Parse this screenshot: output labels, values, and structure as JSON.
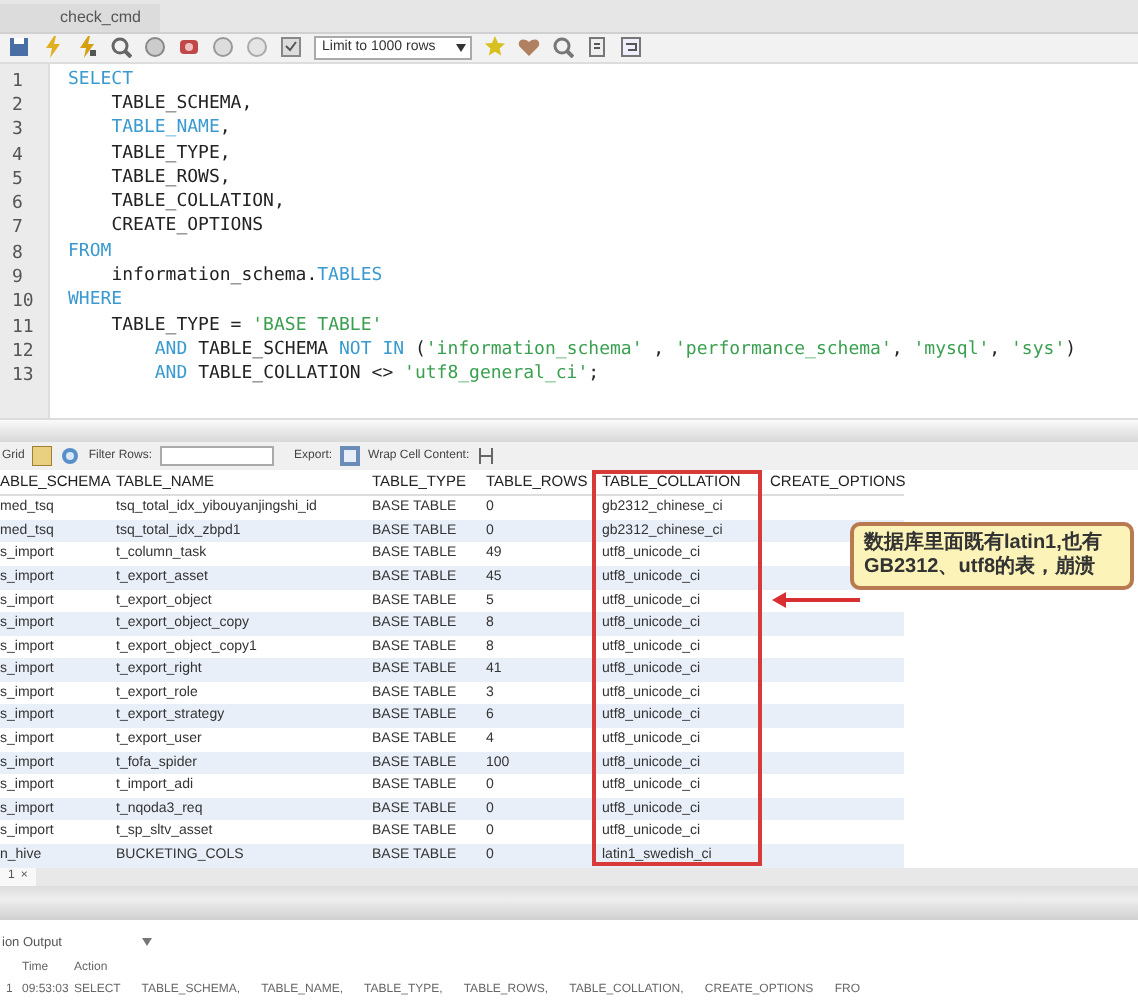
{
  "editor_tab": {
    "title": "check_cmd"
  },
  "toolbar": {
    "limit_select": "Limit to 1000 rows"
  },
  "editor": {
    "lines": [
      {
        "number": "1",
        "kind": "clause",
        "tokens": [
          {
            "kind": "kw",
            "text": "SELECT"
          }
        ]
      },
      {
        "number": "2",
        "kind": "item",
        "tokens": [
          {
            "kind": "plain",
            "text": "TABLE_SCHEMA,"
          }
        ]
      },
      {
        "number": "3",
        "kind": "item",
        "tokens": [
          {
            "kind": "kw",
            "text": "TABLE_NAME"
          },
          {
            "kind": "plain",
            "text": ","
          }
        ]
      },
      {
        "number": "4",
        "kind": "item",
        "tokens": [
          {
            "kind": "plain",
            "text": "TABLE_TYPE,"
          }
        ]
      },
      {
        "number": "5",
        "kind": "item",
        "tokens": [
          {
            "kind": "plain",
            "text": "TABLE_ROWS,"
          }
        ]
      },
      {
        "number": "6",
        "kind": "item",
        "tokens": [
          {
            "kind": "plain",
            "text": "TABLE_COLLATION,"
          }
        ]
      },
      {
        "number": "7",
        "kind": "item",
        "tokens": [
          {
            "kind": "plain",
            "text": "CREATE_OPTIONS"
          }
        ]
      },
      {
        "number": "8",
        "kind": "clause",
        "tokens": [
          {
            "kind": "kw",
            "text": "FROM"
          }
        ]
      },
      {
        "number": "9",
        "kind": "item",
        "tokens": [
          {
            "kind": "plain",
            "text": "information_schema."
          },
          {
            "kind": "kw",
            "text": "TABLES"
          }
        ]
      },
      {
        "number": "10",
        "kind": "clause",
        "tokens": [
          {
            "kind": "kw",
            "text": "WHERE"
          }
        ]
      },
      {
        "number": "11",
        "kind": "item",
        "tokens": [
          {
            "kind": "plain",
            "text": "TABLE_TYPE = "
          },
          {
            "kind": "str",
            "text": "'BASE TABLE'"
          }
        ]
      },
      {
        "number": "12",
        "kind": "condition",
        "tokens": [
          {
            "kind": "kw",
            "text": "AND"
          },
          {
            "kind": "plain",
            "text": " TABLE_SCHEMA "
          },
          {
            "kind": "kw",
            "text": "NOT IN"
          },
          {
            "kind": "plain",
            "text": " ("
          },
          {
            "kind": "str",
            "text": "'information_schema'"
          },
          {
            "kind": "plain",
            "text": " , "
          },
          {
            "kind": "str",
            "text": "'performance_schema'"
          },
          {
            "kind": "plain",
            "text": ", "
          },
          {
            "kind": "str",
            "text": "'mysql'"
          },
          {
            "kind": "plain",
            "text": ", "
          },
          {
            "kind": "str",
            "text": "'sys'"
          },
          {
            "kind": "plain",
            "text": ")"
          }
        ]
      },
      {
        "number": "13",
        "kind": "condition",
        "tokens": [
          {
            "kind": "kw",
            "text": "AND"
          },
          {
            "kind": "plain",
            "text": " TABLE_COLLATION <> "
          },
          {
            "kind": "str",
            "text": "'utf8_general_ci'"
          },
          {
            "kind": "plain",
            "text": ";"
          }
        ]
      }
    ]
  },
  "result_toolbar": {
    "grid_label": "Grid",
    "filter_label": "Filter Rows:",
    "export_label": "Export:",
    "wrap_label": "Wrap Cell Content:"
  },
  "result_grid": {
    "columns": [
      "ABLE_SCHEMA",
      "TABLE_NAME",
      "TABLE_TYPE",
      "TABLE_ROWS",
      "TABLE_COLLATION",
      "CREATE_OPTIONS"
    ],
    "rows": [
      [
        "med_tsq",
        "tsq_total_idx_yibouyanjingshi_id",
        "BASE TABLE",
        "0",
        "gb2312_chinese_ci"
      ],
      [
        "med_tsq",
        "tsq_total_idx_zbpd1",
        "BASE TABLE",
        "0",
        "gb2312_chinese_ci"
      ],
      [
        "s_import",
        "t_column_task",
        "BASE TABLE",
        "49",
        "utf8_unicode_ci"
      ],
      [
        "s_import",
        "t_export_asset",
        "BASE TABLE",
        "45",
        "utf8_unicode_ci"
      ],
      [
        "s_import",
        "t_export_object",
        "BASE TABLE",
        "5",
        "utf8_unicode_ci"
      ],
      [
        "s_import",
        "t_export_object_copy",
        "BASE TABLE",
        "8",
        "utf8_unicode_ci"
      ],
      [
        "s_import",
        "t_export_object_copy1",
        "BASE TABLE",
        "8",
        "utf8_unicode_ci"
      ],
      [
        "s_import",
        "t_export_right",
        "BASE TABLE",
        "41",
        "utf8_unicode_ci"
      ],
      [
        "s_import",
        "t_export_role",
        "BASE TABLE",
        "3",
        "utf8_unicode_ci"
      ],
      [
        "s_import",
        "t_export_strategy",
        "BASE TABLE",
        "6",
        "utf8_unicode_ci"
      ],
      [
        "s_import",
        "t_export_user",
        "BASE TABLE",
        "4",
        "utf8_unicode_ci"
      ],
      [
        "s_import",
        "t_fofa_spider",
        "BASE TABLE",
        "100",
        "utf8_unicode_ci"
      ],
      [
        "s_import",
        "t_import_adi",
        "BASE TABLE",
        "0",
        "utf8_unicode_ci"
      ],
      [
        "s_import",
        "t_nqoda3_req",
        "BASE TABLE",
        "0",
        "utf8_unicode_ci"
      ],
      [
        "s_import",
        "t_sp_sltv_asset",
        "BASE TABLE",
        "0",
        "utf8_unicode_ci"
      ],
      [
        "n_hive",
        "BUCKETING_COLS",
        "BASE TABLE",
        "0",
        "latin1_swedish_ci"
      ]
    ]
  },
  "annotation": {
    "text": "数据库里面既有latin1,也有GB2312、utf8的表，崩溃"
  },
  "result_tabs": [
    {
      "label": "1",
      "close": "×",
      "selected": true
    }
  ],
  "output": {
    "title": "ion Output",
    "columns": [
      "Time",
      "Action"
    ],
    "rows": [
      {
        "number": "1",
        "time": "09:53:03",
        "action": "SELECT TABLE_SCHEMA, TABLE_NAME, TABLE_TYPE, TABLE_ROWS, TABLE_COLLATION, CREATE_OPTIONS FRO"
      }
    ]
  }
}
